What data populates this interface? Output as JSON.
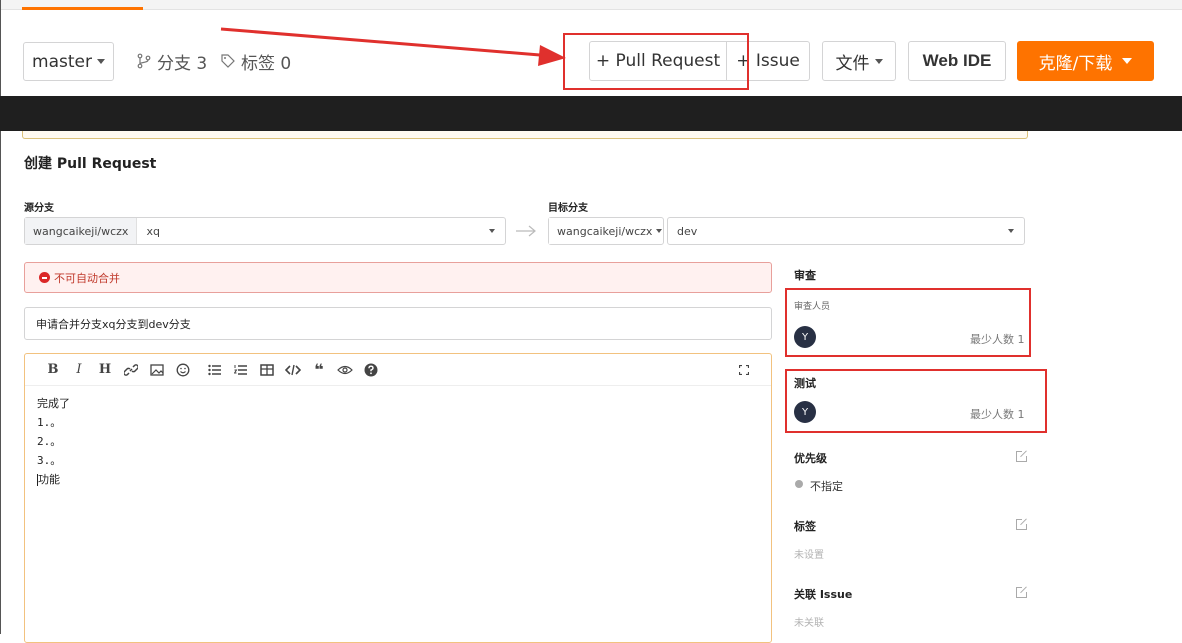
{
  "toolbar": {
    "branch": "master",
    "branches": "分支 3",
    "tags": "标签 0",
    "pull_request": "+ Pull Request",
    "issue": "+ Issue",
    "file": "文件",
    "web_ide": "Web IDE",
    "clone": "克隆/下载"
  },
  "form": {
    "title": "创建 Pull Request",
    "source_label": "源分支",
    "source_owner": "wangcaikeji/wczx",
    "source_branch": "xq",
    "target_label": "目标分支",
    "target_owner": "wangcaikeji/wczx",
    "target_branch": "dev",
    "merge_error": "不可自动合并",
    "pr_title": "申请合并分支xq分支到dev分支",
    "body_lines": [
      "完成了",
      "1.。",
      "2.。",
      "3.。"
    ],
    "body_last": "功能"
  },
  "editor_tools": [
    "B",
    "I",
    "H",
    "link",
    "image",
    "emoji",
    "unordered-list",
    "ordered-list",
    "table",
    "code",
    "quote",
    "preview",
    "help",
    "fullscreen"
  ],
  "sidebar": {
    "review_title": "审查",
    "reviewers_label": "审查人员",
    "reviewer_avatar": "Y",
    "reviewer_min": "最少人数 1",
    "test_title": "测试",
    "tester_avatar": "Y",
    "tester_min": "最少人数 1",
    "priority_title": "优先级",
    "priority_value": "不指定",
    "labels_title": "标签",
    "labels_value": "未设置",
    "issue_title": "关联 Issue",
    "issue_value": "未关联"
  },
  "colors": {
    "brand_orange": "#fe7300",
    "annotation_red": "#e0302d",
    "avatar_navy": "#283044",
    "error_red": "#db2828"
  }
}
